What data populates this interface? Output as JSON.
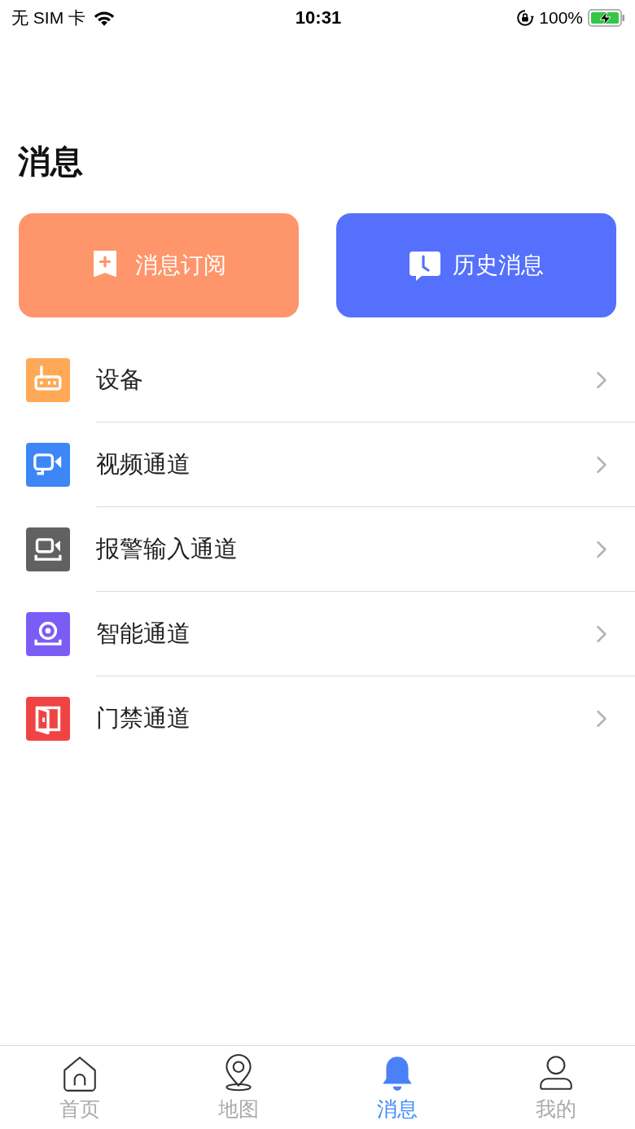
{
  "status_bar": {
    "carrier": "无 SIM 卡",
    "time": "10:31",
    "battery": "100%"
  },
  "title": "消息",
  "actions": [
    {
      "label": "消息订阅",
      "kind": "subscribe",
      "color": "#ff956b"
    },
    {
      "label": "历史消息",
      "kind": "history",
      "color": "#5470fc"
    }
  ],
  "items": [
    {
      "label": "设备",
      "kind": "router",
      "color": "#ffa957"
    },
    {
      "label": "视频通道",
      "kind": "camera",
      "color": "#3d86f6"
    },
    {
      "label": "报警输入通道",
      "kind": "alarm",
      "color": "#616161"
    },
    {
      "label": "智能通道",
      "kind": "smart",
      "color": "#7b5df6"
    },
    {
      "label": "门禁通道",
      "kind": "door",
      "color": "#f04444"
    }
  ],
  "tabs": [
    {
      "label": "首页",
      "kind": "home",
      "selected": false
    },
    {
      "label": "地图",
      "kind": "map",
      "selected": false
    },
    {
      "label": "消息",
      "kind": "bell",
      "selected": true
    },
    {
      "label": "我的",
      "kind": "user",
      "selected": false
    }
  ]
}
